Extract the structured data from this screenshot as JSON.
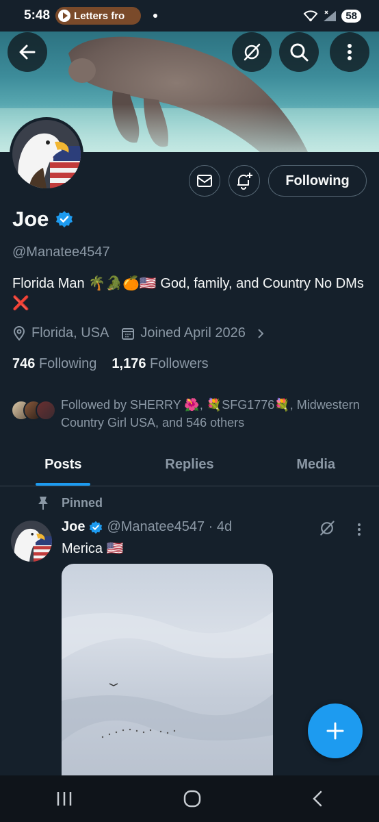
{
  "status_bar": {
    "time": "5:48",
    "media_text": "Letters fro",
    "battery": "58"
  },
  "profile": {
    "name": "Joe",
    "handle": "@Manatee4547",
    "bio": "Florida Man 🌴🐊🍊🇺🇸  God, family, and Country No DMs ❌",
    "location": "Florida, USA",
    "joined": "Joined April 2026",
    "following_count": "746",
    "following_label": "Following",
    "followers_count": "1,176",
    "followers_label": "Followers",
    "followed_by": "Followed by SHERRY 🌺, 💐SFG1776💐, Midwestern Country Girl USA, and 546 others"
  },
  "actions": {
    "following_button": "Following"
  },
  "tabs": [
    {
      "label": "Posts",
      "active": true
    },
    {
      "label": "Replies",
      "active": false
    },
    {
      "label": "Media",
      "active": false
    }
  ],
  "pinned_post": {
    "pinned_label": "Pinned",
    "author_name": "Joe",
    "author_handle": "@Manatee4547 · 4d",
    "text": "Merica 🇺🇸"
  },
  "colors": {
    "background": "#15202b",
    "accent": "#1d9bf0",
    "muted_text": "#8b98a5",
    "border": "#536471"
  },
  "icons": [
    "back-arrow-icon",
    "grok-icon",
    "search-icon",
    "more-vertical-icon",
    "mail-icon",
    "bell-plus-icon",
    "verified-badge-icon",
    "location-icon",
    "calendar-icon",
    "chevron-right-icon",
    "pin-icon",
    "plus-icon"
  ]
}
